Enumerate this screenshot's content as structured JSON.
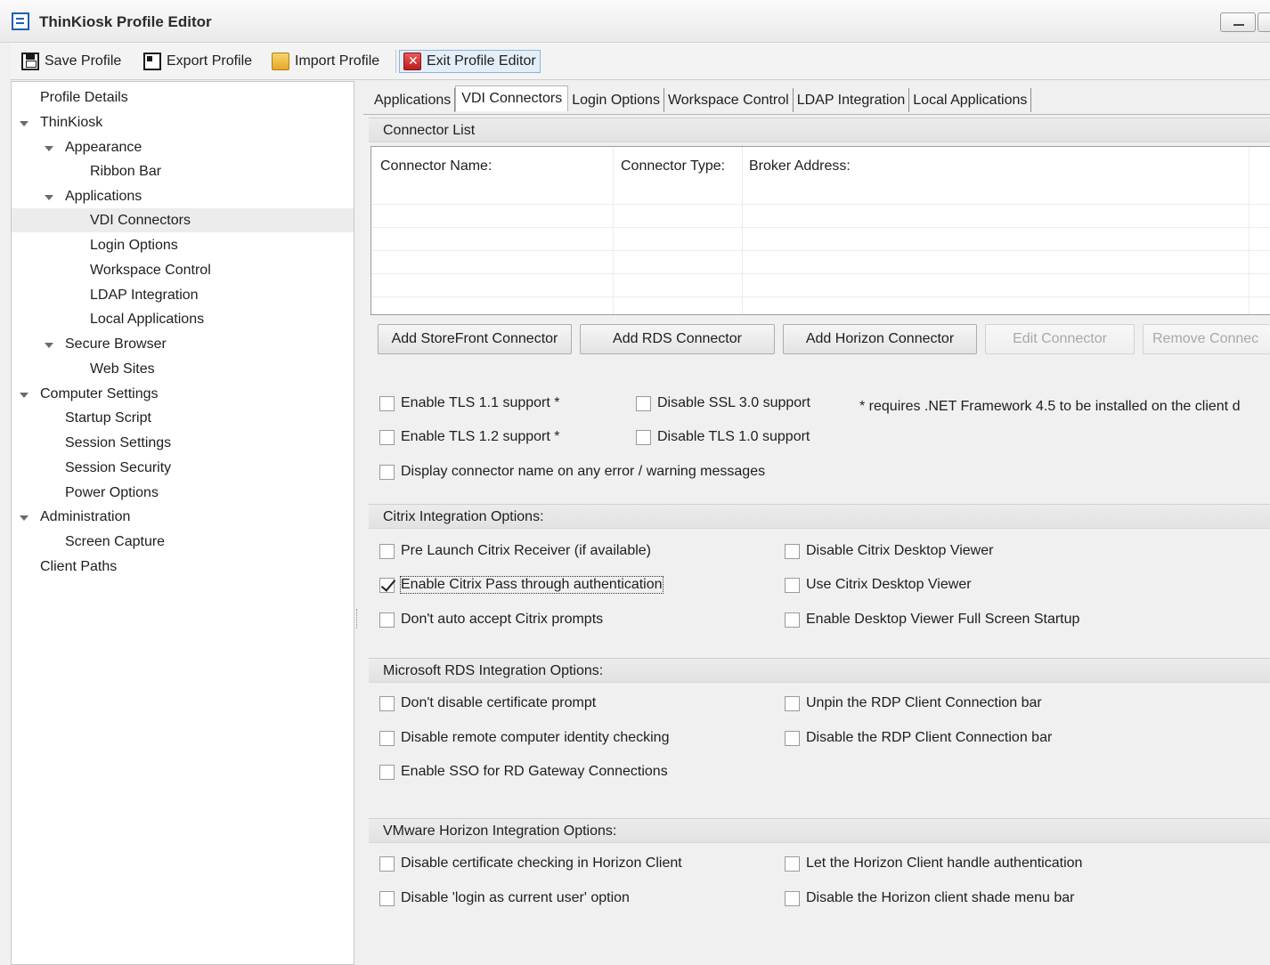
{
  "window": {
    "title": "ThinKiosk Profile Editor"
  },
  "toolbar": {
    "save": "Save Profile",
    "export": "Export Profile",
    "import": "Import Profile",
    "exit": "Exit Profile Editor"
  },
  "tree": {
    "items": [
      "Profile Details",
      "ThinKiosk",
      "Appearance",
      "Ribbon Bar",
      "Applications",
      "VDI Connectors",
      "Login Options",
      "Workspace Control",
      "LDAP Integration",
      "Local Applications",
      "Secure Browser",
      "Web Sites",
      "Computer Settings",
      "Startup Script",
      "Session Settings",
      "Session Security",
      "Power Options",
      "Administration",
      "Screen Capture",
      "Client Paths"
    ],
    "selected": "VDI Connectors"
  },
  "tabs": [
    "Applications",
    "VDI Connectors",
    "Login Options",
    "Workspace Control",
    "LDAP Integration",
    "Local Applications"
  ],
  "active_tab": "VDI Connectors",
  "connector_list": {
    "title": "Connector List",
    "columns": [
      "Connector Name:",
      "Connector Type:",
      "Broker Address:"
    ],
    "rows": []
  },
  "buttons": {
    "add_storefront": "Add StoreFront Connector",
    "add_rds": "Add RDS Connector",
    "add_horizon": "Add Horizon Connector",
    "edit": "Edit Connector",
    "remove": "Remove Connec"
  },
  "tls": {
    "tls11": "Enable TLS 1.1 support *",
    "tls12": "Enable TLS 1.2 support *",
    "ssl30": "Disable SSL 3.0 support",
    "tls10": "Disable TLS 1.0 support",
    "display_name": "Display connector name on any error / warning messages",
    "note": "* requires .NET Framework 4.5 to be installed on the client d"
  },
  "citrix": {
    "title": "Citrix Integration Options:",
    "prelaunch": "Pre Launch Citrix Receiver (if available)",
    "passthrough": "Enable Citrix Pass through authentication",
    "no_auto_accept": "Don't auto accept Citrix prompts",
    "disable_viewer": "Disable Citrix Desktop Viewer",
    "use_viewer": "Use Citrix Desktop Viewer",
    "fullscreen": "Enable Desktop Viewer Full Screen Startup"
  },
  "rds": {
    "title": "Microsoft RDS Integration Options:",
    "cert_prompt": "Don't disable certificate prompt",
    "identity": "Disable remote computer identity checking",
    "sso": "Enable SSO for RD Gateway Connections",
    "unpin": "Unpin the RDP Client Connection bar",
    "disable_bar": "Disable the RDP Client Connection bar"
  },
  "horizon": {
    "title": "VMware Horizon Integration Options:",
    "cert_check": "Disable certificate checking in Horizon Client",
    "login_current": "Disable 'login as current user' option",
    "handle_auth": "Let the Horizon Client handle authentication",
    "shade_menu": "Disable the Horizon client shade menu bar"
  }
}
